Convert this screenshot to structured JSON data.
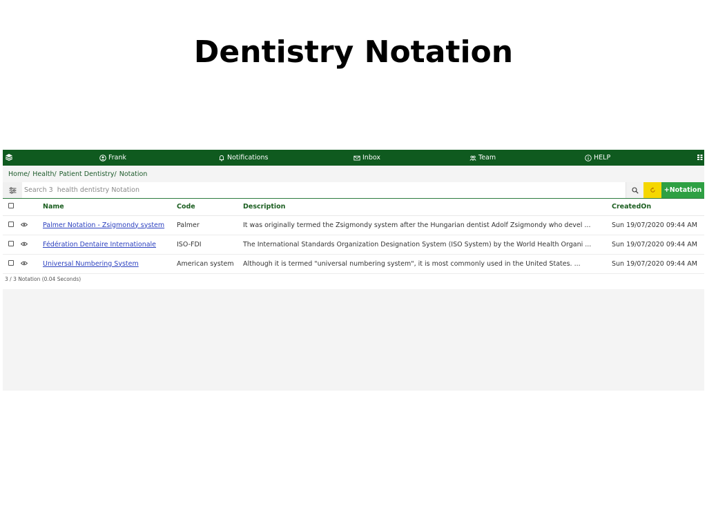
{
  "page": {
    "title": "Dentistry Notation"
  },
  "topbar": {
    "items": [
      {
        "label": "Frank",
        "icon": "user-icon"
      },
      {
        "label": "Notifications",
        "icon": "bell-icon"
      },
      {
        "label": "Inbox",
        "icon": "envelope-icon"
      },
      {
        "label": "Team",
        "icon": "team-icon"
      },
      {
        "label": "HELP",
        "icon": "info-icon"
      }
    ],
    "color": "#0f5a1f"
  },
  "breadcrumb": [
    "Home/",
    "Health/",
    "Patient Dentistry/",
    "Notation"
  ],
  "search": {
    "placeholder": "Search 3  health dentistry Notation",
    "value": ""
  },
  "actions": {
    "add_label": "+Notation",
    "refresh_color": "#f5d700",
    "add_color": "#2ea043"
  },
  "table": {
    "columns": [
      "Name",
      "Code",
      "Description",
      "CreatedOn"
    ],
    "rows": [
      {
        "name": "Palmer Notation - Zsigmondy system",
        "code": "Palmer",
        "description": "It was originally termed the Zsigmondy system after the Hungarian dentist Adolf Zsigmondy who devel ...",
        "created": "Sun 19/07/2020 09:44 AM"
      },
      {
        "name": "Fédération Dentaire Internationale",
        "code": "ISO-FDI",
        "description": "The International Standards Organization Designation System (ISO System) by the World Health Organi ...",
        "created": "Sun 19/07/2020 09:44 AM"
      },
      {
        "name": "Universal Numbering System",
        "code": "American system",
        "description": "Although it is termed \"universal numbering system\", it is most commonly used in the United States. ...",
        "created": "Sun 19/07/2020 09:44 AM"
      }
    ]
  },
  "footer": {
    "summary": "3 / 3 Notation (0.04 Seconds)"
  }
}
